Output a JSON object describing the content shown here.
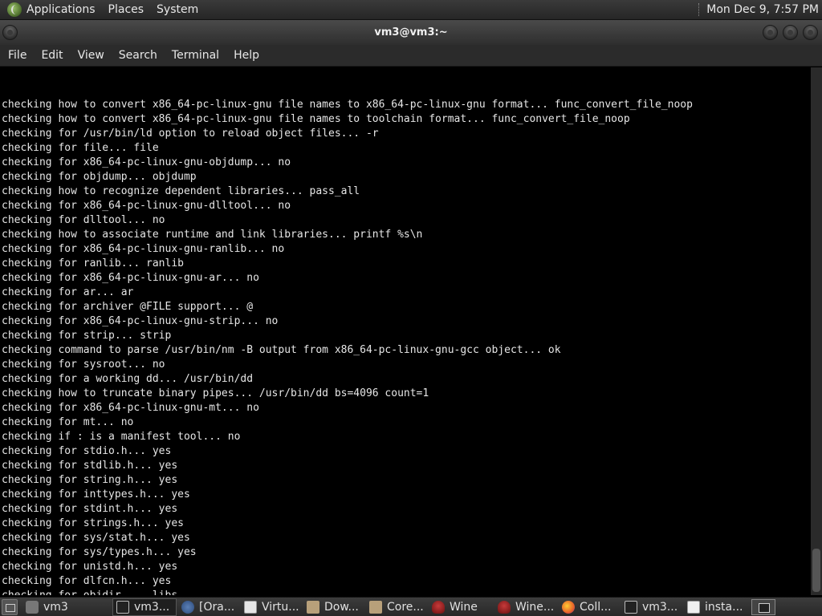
{
  "top_panel": {
    "menus": [
      "Applications",
      "Places",
      "System"
    ],
    "clock": "Mon Dec 9, 7:57 PM"
  },
  "window": {
    "title": "vm3@vm3:~"
  },
  "menubar": [
    "File",
    "Edit",
    "View",
    "Search",
    "Terminal",
    "Help"
  ],
  "terminal_lines": [
    "checking how to convert x86_64-pc-linux-gnu file names to x86_64-pc-linux-gnu format... func_convert_file_noop",
    "checking how to convert x86_64-pc-linux-gnu file names to toolchain format... func_convert_file_noop",
    "checking for /usr/bin/ld option to reload object files... -r",
    "checking for file... file",
    "checking for x86_64-pc-linux-gnu-objdump... no",
    "checking for objdump... objdump",
    "checking how to recognize dependent libraries... pass_all",
    "checking for x86_64-pc-linux-gnu-dlltool... no",
    "checking for dlltool... no",
    "checking how to associate runtime and link libraries... printf %s\\n",
    "checking for x86_64-pc-linux-gnu-ranlib... no",
    "checking for ranlib... ranlib",
    "checking for x86_64-pc-linux-gnu-ar... no",
    "checking for ar... ar",
    "checking for archiver @FILE support... @",
    "checking for x86_64-pc-linux-gnu-strip... no",
    "checking for strip... strip",
    "checking command to parse /usr/bin/nm -B output from x86_64-pc-linux-gnu-gcc object... ok",
    "checking for sysroot... no",
    "checking for a working dd... /usr/bin/dd",
    "checking how to truncate binary pipes... /usr/bin/dd bs=4096 count=1",
    "checking for x86_64-pc-linux-gnu-mt... no",
    "checking for mt... no",
    "checking if : is a manifest tool... no",
    "checking for stdio.h... yes",
    "checking for stdlib.h... yes",
    "checking for string.h... yes",
    "checking for inttypes.h... yes",
    "checking for stdint.h... yes",
    "checking for strings.h... yes",
    "checking for sys/stat.h... yes",
    "checking for sys/types.h... yes",
    "checking for unistd.h... yes",
    "checking for dlfcn.h... yes",
    "checking for objdir... .libs"
  ],
  "taskbar": [
    {
      "label": "vm3",
      "icon": "home-icon"
    },
    {
      "label": "vm3...",
      "icon": "terminal-icon",
      "active": true
    },
    {
      "label": "[Ora...",
      "icon": "java-icon"
    },
    {
      "label": "Virtu...",
      "icon": "virtualbox-icon"
    },
    {
      "label": "Dow...",
      "icon": "folder-icon"
    },
    {
      "label": "Core...",
      "icon": "folder-icon"
    },
    {
      "label": "Wine",
      "icon": "wine-icon"
    },
    {
      "label": "Wine...",
      "icon": "wine-icon"
    },
    {
      "label": "Coll...",
      "icon": "firefox-icon"
    },
    {
      "label": "vm3...",
      "icon": "terminal-icon"
    },
    {
      "label": "insta...",
      "icon": "text-editor-icon"
    }
  ]
}
